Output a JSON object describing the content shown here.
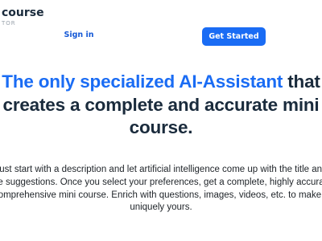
{
  "brand": {
    "name": "course",
    "tagline": "TOR"
  },
  "nav": {
    "sign_in_label": "Sign in",
    "cta_label": "Get Started"
  },
  "hero": {
    "accent": "The only specialized AI-Assistant",
    "line1_rest": " that",
    "line2": "creates a complete and accurate mini",
    "line3": "course."
  },
  "description": {
    "lines": [
      "Just start with a description and let artificial intelligence come up with the title and",
      "the suggestions. Once you select your preferences, get a complete, highly accurate",
      "comprehensive mini course. Enrich with questions, images, videos, etc. to make it",
      "uniquely yours."
    ]
  },
  "colors": {
    "accent": "#1a6cf4",
    "heading": "#1a2b3c",
    "body_text": "#1e2328"
  }
}
